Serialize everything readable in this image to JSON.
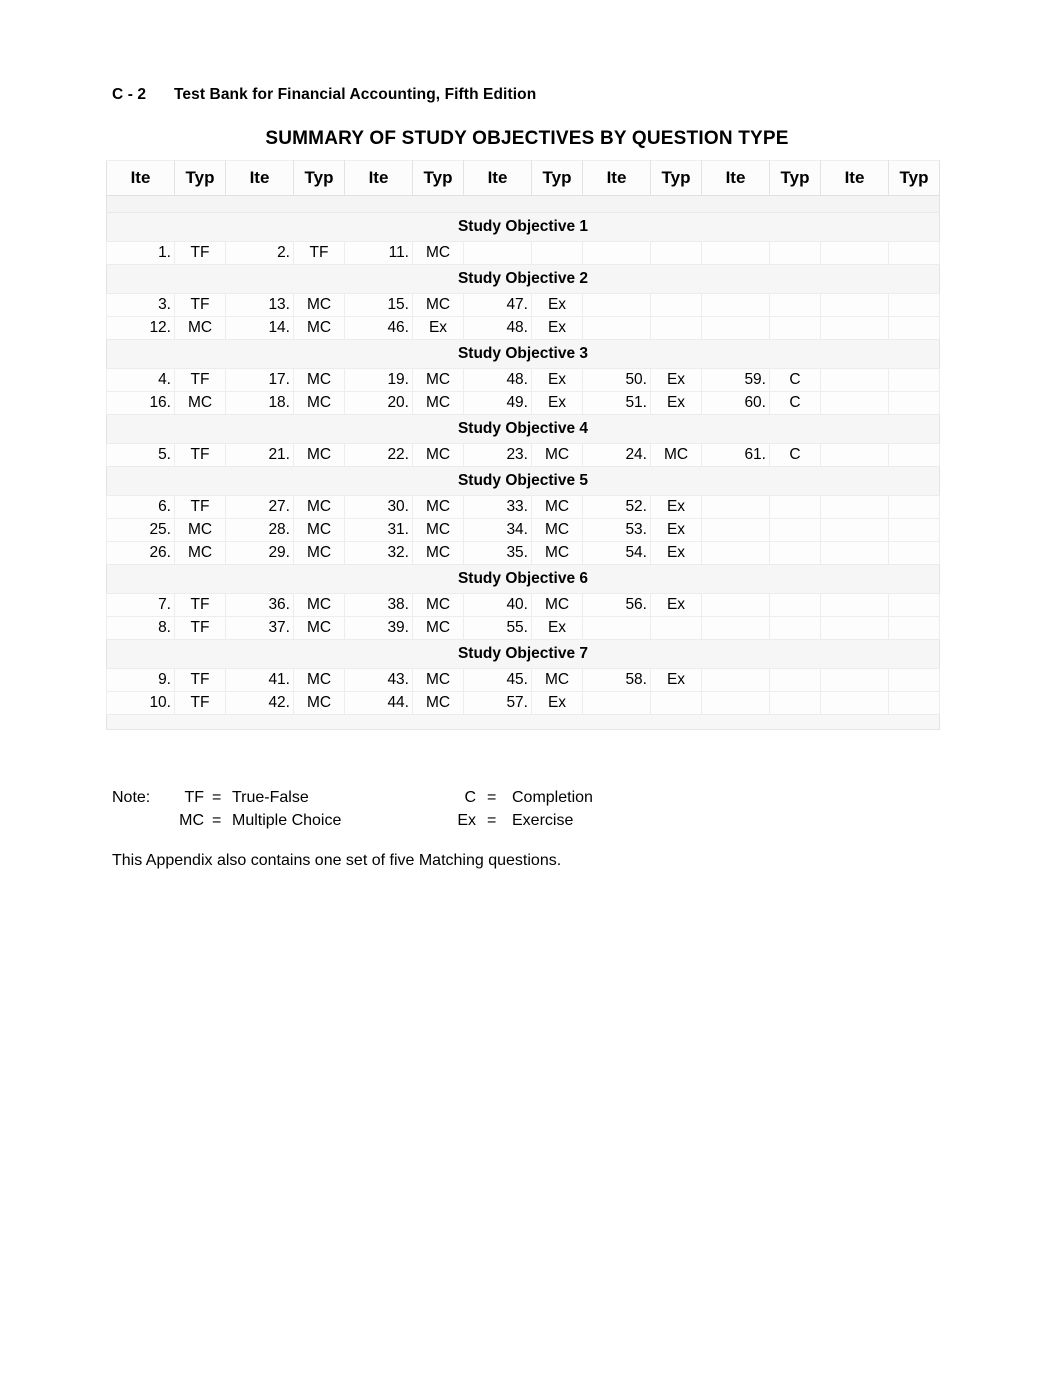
{
  "header": {
    "folio": "C - 2",
    "title": "Test Bank for Financial Accounting, Fifth Edition"
  },
  "caption": "SUMMARY OF STUDY OBJECTIVES BY QUESTION TYPE",
  "table": {
    "column_headers": [
      "Ite",
      "Typ",
      "Ite",
      "Typ",
      "Ite",
      "Typ",
      "Ite",
      "Typ",
      "Ite",
      "Typ",
      "Ite",
      "Typ",
      "Ite",
      "Typ"
    ],
    "column_pairs": 7,
    "blocks": [
      {
        "title": "Study Objective 1",
        "rows": [
          [
            "1.",
            "TF",
            "2.",
            "TF",
            "11.",
            "MC",
            "",
            "",
            "",
            "",
            "",
            "",
            "",
            ""
          ]
        ]
      },
      {
        "title": "Study Objective 2",
        "rows": [
          [
            "3.",
            "TF",
            "13.",
            "MC",
            "15.",
            "MC",
            "47.",
            "Ex",
            "",
            "",
            "",
            "",
            "",
            ""
          ],
          [
            "12.",
            "MC",
            "14.",
            "MC",
            "46.",
            "Ex",
            "48.",
            "Ex",
            "",
            "",
            "",
            "",
            "",
            ""
          ]
        ]
      },
      {
        "title": "Study Objective 3",
        "rows": [
          [
            "4.",
            "TF",
            "17.",
            "MC",
            "19.",
            "MC",
            "48.",
            "Ex",
            "50.",
            "Ex",
            "59.",
            "C",
            "",
            ""
          ],
          [
            "16.",
            "MC",
            "18.",
            "MC",
            "20.",
            "MC",
            "49.",
            "Ex",
            "51.",
            "Ex",
            "60.",
            "C",
            "",
            ""
          ]
        ]
      },
      {
        "title": "Study Objective 4",
        "rows": [
          [
            "5.",
            "TF",
            "21.",
            "MC",
            "22.",
            "MC",
            "23.",
            "MC",
            "24.",
            "MC",
            "61.",
            "C",
            "",
            ""
          ]
        ]
      },
      {
        "title": "Study Objective 5",
        "rows": [
          [
            "6.",
            "TF",
            "27.",
            "MC",
            "30.",
            "MC",
            "33.",
            "MC",
            "52.",
            "Ex",
            "",
            "",
            "",
            ""
          ],
          [
            "25.",
            "MC",
            "28.",
            "MC",
            "31.",
            "MC",
            "34.",
            "MC",
            "53.",
            "Ex",
            "",
            "",
            "",
            ""
          ],
          [
            "26.",
            "MC",
            "29.",
            "MC",
            "32.",
            "MC",
            "35.",
            "MC",
            "54.",
            "Ex",
            "",
            "",
            "",
            ""
          ]
        ]
      },
      {
        "title": "Study Objective 6",
        "rows": [
          [
            "7.",
            "TF",
            "36.",
            "MC",
            "38.",
            "MC",
            "40.",
            "MC",
            "56.",
            "Ex",
            "",
            "",
            "",
            ""
          ],
          [
            "8.",
            "TF",
            "37.",
            "MC",
            "39.",
            "MC",
            "55.",
            "Ex",
            "",
            "",
            "",
            "",
            "",
            ""
          ]
        ]
      },
      {
        "title": "Study Objective 7",
        "rows": [
          [
            "9.",
            "TF",
            "41.",
            "MC",
            "43.",
            "MC",
            "45.",
            "MC",
            "58.",
            "Ex",
            "",
            "",
            "",
            ""
          ],
          [
            "10.",
            "TF",
            "42.",
            "MC",
            "44.",
            "MC",
            "57.",
            "Ex",
            "",
            "",
            "",
            "",
            "",
            ""
          ]
        ]
      }
    ]
  },
  "note": {
    "label": "Note:",
    "entries": [
      {
        "abbr": "TF",
        "eq": "=",
        "definition": "True-False"
      },
      {
        "abbr": "MC",
        "eq": "=",
        "definition": "Multiple Choice"
      }
    ],
    "entries_right": [
      {
        "abbr": "C",
        "eq": "=",
        "definition": "Completion"
      },
      {
        "abbr": "Ex",
        "eq": "=",
        "definition": "Exercise"
      }
    ]
  },
  "appendix_note": "This Appendix also contains one set of five Matching questions."
}
